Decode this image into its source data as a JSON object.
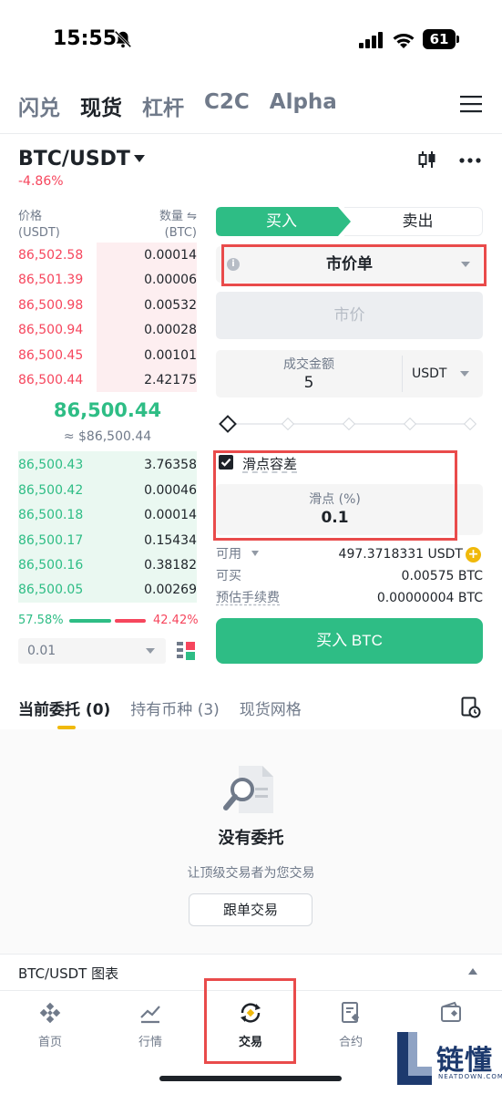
{
  "status_bar": {
    "time": "15:55",
    "battery": "61"
  },
  "top_tabs": [
    "闪兑",
    "现货",
    "杠杆",
    "C2C",
    "Alpha"
  ],
  "top_tab_active": 1,
  "pair": {
    "symbol": "BTC/USDT",
    "change": "-4.86%"
  },
  "order_book": {
    "price_header": "价格",
    "price_unit": "(USDT)",
    "qty_header": "数量 ⇋",
    "qty_unit": "(BTC)",
    "asks": [
      {
        "price": "86,502.58",
        "qty": "0.00014"
      },
      {
        "price": "86,501.39",
        "qty": "0.00006"
      },
      {
        "price": "86,500.98",
        "qty": "0.00532"
      },
      {
        "price": "86,500.94",
        "qty": "0.00028"
      },
      {
        "price": "86,500.45",
        "qty": "0.00101"
      },
      {
        "price": "86,500.44",
        "qty": "2.42175"
      }
    ],
    "mid_price": "86,500.44",
    "mid_usd": "≈ $86,500.44",
    "bids": [
      {
        "price": "86,500.43",
        "qty": "3.76358"
      },
      {
        "price": "86,500.42",
        "qty": "0.00046"
      },
      {
        "price": "86,500.18",
        "qty": "0.00014"
      },
      {
        "price": "86,500.17",
        "qty": "0.15434"
      },
      {
        "price": "86,500.16",
        "qty": "0.38182"
      },
      {
        "price": "86,500.05",
        "qty": "0.00269"
      }
    ],
    "buy_ratio": "57.58%",
    "sell_ratio": "42.42%",
    "precision": "0.01"
  },
  "order_form": {
    "buy_tab": "买入",
    "sell_tab": "卖出",
    "order_type": "市价单",
    "price_placeholder": "市价",
    "amount_label": "成交金额",
    "amount_value": "5",
    "amount_unit": "USDT",
    "slippage_label": "滑点容差",
    "slippage_field_label": "滑点 (%)",
    "slippage_value": "0.1",
    "available_label": "可用",
    "available_value": "497.3718331 USDT",
    "can_buy_label": "可买",
    "can_buy_value": "0.00575 BTC",
    "fee_label": "预估手续费",
    "fee_value": "0.00000004 BTC",
    "submit_label": "买入 BTC"
  },
  "orders": {
    "tabs": [
      "当前委托 (0)",
      "持有币种 (3)",
      "现货网格"
    ],
    "empty_title": "没有委托",
    "empty_subtitle": "让顶级交易者为您交易",
    "copy_button": "跟单交易",
    "chart_bar": "BTC/USDT 图表"
  },
  "bottom_nav": [
    "首页",
    "行情",
    "交易",
    "合约",
    "钱包"
  ],
  "bottom_nav_active": 2,
  "watermark": {
    "name": "链懂",
    "sub": "NEATDOWN.COM"
  },
  "colors": {
    "buy": "#2ebd85",
    "sell": "#f6465d",
    "accent": "#f0b90b",
    "highlight_box": "#e94b4b"
  }
}
